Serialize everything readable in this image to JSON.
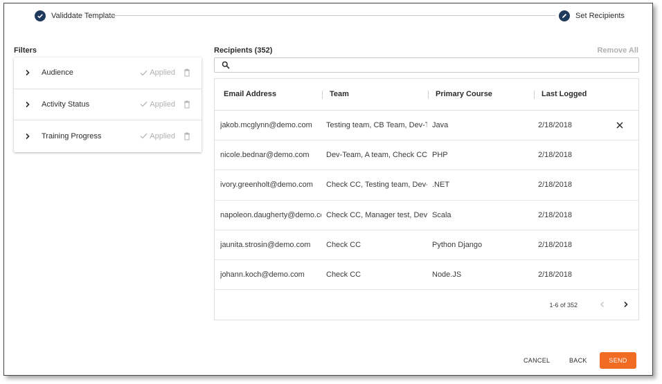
{
  "stepper": {
    "step1_label": "Validdate Template",
    "step2_label": "Set Recipients"
  },
  "filters": {
    "title": "Filters",
    "items": [
      {
        "label": "Audience",
        "status": "Applied"
      },
      {
        "label": "Activity Status",
        "status": "Applied"
      },
      {
        "label": "Training Progress",
        "status": "Applied"
      }
    ]
  },
  "recipients": {
    "title": "Recipients (352)",
    "remove_all_label": "Remove All",
    "search_placeholder": "",
    "columns": [
      "Email Address",
      "Team",
      "Primary Course",
      "Last Logged"
    ],
    "rows": [
      {
        "email": "jakob.mcglynn@demo.com",
        "team": "Testing team, CB Team, Dev-Team",
        "course": "Java",
        "date": "2/18/2018"
      },
      {
        "email": "nicole.bednar@demo.com",
        "team": "Dev-Team, A team, Check CC, Testing team",
        "course": "PHP",
        "date": "2/18/2018"
      },
      {
        "email": "ivory.greenholt@demo.com",
        "team": "Check CC, Testing team, Dev-Team",
        "course": ".NET",
        "date": "2/18/2018"
      },
      {
        "email": "napoleon.daugherty@demo.com",
        "team": "Check CC, Manager test, Dev-Team",
        "course": "Scala",
        "date": "2/18/2018"
      },
      {
        "email": "jaunita.strosin@demo.com",
        "team": "Check CC",
        "course": "Python Django",
        "date": "2/18/2018"
      },
      {
        "email": "johann.koch@demo.com",
        "team": "Check CC",
        "course": "Node.JS",
        "date": "2/18/2018"
      }
    ],
    "pagination": "1-6 of 352"
  },
  "actions": {
    "cancel_label": "CANCEL",
    "back_label": "BACK",
    "send_label": "SEND"
  },
  "colors": {
    "accent": "#f26b22",
    "step_circle": "#1f3a5c",
    "muted": "#b0b0b0"
  }
}
